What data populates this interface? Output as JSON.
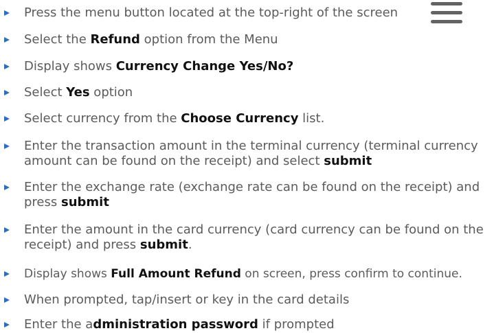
{
  "colors": {
    "bullet": "#2a6fc0",
    "text": "#5b5b5b",
    "emphasis": "#111111",
    "menu_icon": "#636363"
  },
  "icons": {
    "menu": "hamburger-menu-icon",
    "bullet": "triangle-bullet-icon"
  },
  "steps": [
    {
      "text": "Press the menu button located at the top-right of the screen"
    },
    {
      "pre": "Select the ",
      "bold": "Refund",
      "post": " option from the Menu"
    },
    {
      "pre": "Display shows ",
      "bold": "Currency Change Yes/No?",
      "post": ""
    },
    {
      "pre": "Select ",
      "bold": "Yes",
      "post": " option"
    },
    {
      "pre": "Select currency from the ",
      "bold": "Choose Currency",
      "post": " list."
    },
    {
      "pre": "Enter the transaction amount in the terminal currency (terminal currency amount can be found on the receipt) and select ",
      "bold": "submit",
      "post": ""
    },
    {
      "pre": "Enter the exchange rate (exchange rate can be found on the receipt) and press ",
      "bold": "submit",
      "post": ""
    },
    {
      "pre": "Enter the amount in the card currency (card currency can be found on the receipt) and press ",
      "bold": "submit",
      "post": "."
    },
    {
      "pre": "Display shows ",
      "bold": "Full Amount Refund",
      "post": " on screen, press confirm to continue."
    },
    {
      "text": "When prompted, tap/insert or key in the card details"
    },
    {
      "pre": "Enter the a",
      "bold": "dministration password",
      "post": " if prompted"
    }
  ]
}
